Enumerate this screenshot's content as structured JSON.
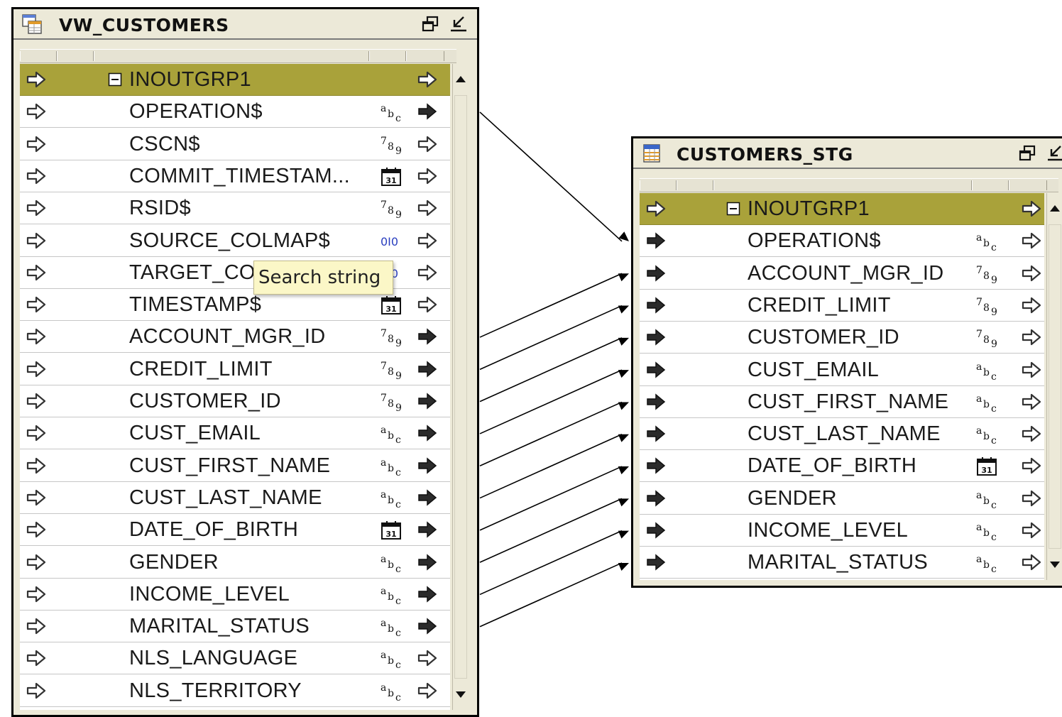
{
  "source_operator": {
    "title": "VW_CUSTOMERS",
    "group": {
      "name": "INOUTGRP1",
      "collapse_glyph": "minus-box-icon"
    },
    "attributes": [
      {
        "name": "OPERATION$",
        "type_icon": "string-type-icon",
        "out_port": "filled-arrow-icon",
        "mapped": true
      },
      {
        "name": "CSCN$",
        "type_icon": "number-type-icon",
        "out_port": "outline-arrow-icon",
        "mapped": false
      },
      {
        "name": "COMMIT_TIMESTAM...",
        "type_icon": "date-type-icon",
        "out_port": "outline-arrow-icon",
        "mapped": false
      },
      {
        "name": "RSID$",
        "type_icon": "number-type-icon",
        "out_port": "outline-arrow-icon",
        "mapped": false
      },
      {
        "name": "SOURCE_COLMAP$",
        "type_icon": "binary-type-icon",
        "out_port": "outline-arrow-icon",
        "mapped": false
      },
      {
        "name": "TARGET_COLMAP$",
        "type_icon": "binary-type-icon",
        "out_port": "outline-arrow-icon",
        "mapped": false
      },
      {
        "name": "TIMESTAMP$",
        "type_icon": "date-type-icon",
        "out_port": "outline-arrow-icon",
        "mapped": false
      },
      {
        "name": "ACCOUNT_MGR_ID",
        "type_icon": "number-type-icon",
        "out_port": "filled-arrow-icon",
        "mapped": true
      },
      {
        "name": "CREDIT_LIMIT",
        "type_icon": "number-type-icon",
        "out_port": "filled-arrow-icon",
        "mapped": true
      },
      {
        "name": "CUSTOMER_ID",
        "type_icon": "number-type-icon",
        "out_port": "filled-arrow-icon",
        "mapped": true
      },
      {
        "name": "CUST_EMAIL",
        "type_icon": "string-type-icon",
        "out_port": "filled-arrow-icon",
        "mapped": true
      },
      {
        "name": "CUST_FIRST_NAME",
        "type_icon": "string-type-icon",
        "out_port": "filled-arrow-icon",
        "mapped": true
      },
      {
        "name": "CUST_LAST_NAME",
        "type_icon": "string-type-icon",
        "out_port": "filled-arrow-icon",
        "mapped": true
      },
      {
        "name": "DATE_OF_BIRTH",
        "type_icon": "date-type-icon",
        "out_port": "filled-arrow-icon",
        "mapped": true
      },
      {
        "name": "GENDER",
        "type_icon": "string-type-icon",
        "out_port": "filled-arrow-icon",
        "mapped": true
      },
      {
        "name": "INCOME_LEVEL",
        "type_icon": "string-type-icon",
        "out_port": "filled-arrow-icon",
        "mapped": true
      },
      {
        "name": "MARITAL_STATUS",
        "type_icon": "string-type-icon",
        "out_port": "filled-arrow-icon",
        "mapped": true
      },
      {
        "name": "NLS_LANGUAGE",
        "type_icon": "string-type-icon",
        "out_port": "outline-arrow-icon",
        "mapped": false
      },
      {
        "name": "NLS_TERRITORY",
        "type_icon": "string-type-icon",
        "out_port": "outline-arrow-icon",
        "mapped": false
      }
    ]
  },
  "target_operator": {
    "title": "CUSTOMERS_STG",
    "group": {
      "name": "INOUTGRP1",
      "collapse_glyph": "minus-box-icon"
    },
    "attributes": [
      {
        "name": "OPERATION$",
        "type_icon": "string-type-icon"
      },
      {
        "name": "ACCOUNT_MGR_ID",
        "type_icon": "number-type-icon"
      },
      {
        "name": "CREDIT_LIMIT",
        "type_icon": "number-type-icon"
      },
      {
        "name": "CUSTOMER_ID",
        "type_icon": "number-type-icon"
      },
      {
        "name": "CUST_EMAIL",
        "type_icon": "string-type-icon"
      },
      {
        "name": "CUST_FIRST_NAME",
        "type_icon": "string-type-icon"
      },
      {
        "name": "CUST_LAST_NAME",
        "type_icon": "string-type-icon"
      },
      {
        "name": "DATE_OF_BIRTH",
        "type_icon": "date-type-icon"
      },
      {
        "name": "GENDER",
        "type_icon": "string-type-icon"
      },
      {
        "name": "INCOME_LEVEL",
        "type_icon": "string-type-icon"
      },
      {
        "name": "MARITAL_STATUS",
        "type_icon": "string-type-icon"
      }
    ]
  },
  "tooltip": {
    "text": "Search string"
  },
  "colors": {
    "group_row": "#a9a23a",
    "panel": "#ece9d8",
    "binary_type": "#2a3fbf",
    "wire": "#000000"
  }
}
